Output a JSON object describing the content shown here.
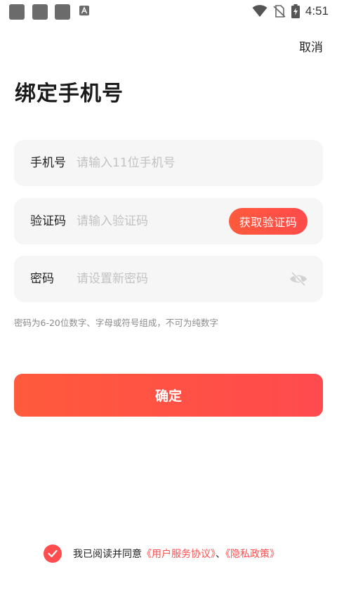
{
  "status_bar": {
    "time": "4:51",
    "icons": [
      "app-notification-icon",
      "app-notification-icon",
      "app-notification-icon",
      "a-notification-icon",
      "wifi-icon",
      "no-sim-icon",
      "battery-charging-icon"
    ]
  },
  "header": {
    "cancel_label": "取消",
    "title": "绑定手机号"
  },
  "form": {
    "phone": {
      "label": "手机号",
      "placeholder": "请输入11位手机号"
    },
    "code": {
      "label": "验证码",
      "placeholder": "请输入验证码",
      "button_label": "获取验证码"
    },
    "password": {
      "label": "密码",
      "placeholder": "请设置新密码"
    },
    "hint": "密码为6-20位数字、字母或符号组成，不可为纯数字",
    "confirm_label": "确定"
  },
  "agreement": {
    "checked": true,
    "prefix": "我已阅读并同意",
    "service_link": "《用户服务协议》",
    "separator": "、",
    "privacy_link": "《隐私政策》"
  },
  "colors": {
    "accent": "#ff4d4f",
    "accent_start": "#ff5a3c",
    "field_bg": "#f6f6f6",
    "placeholder": "#c2c2c2"
  }
}
